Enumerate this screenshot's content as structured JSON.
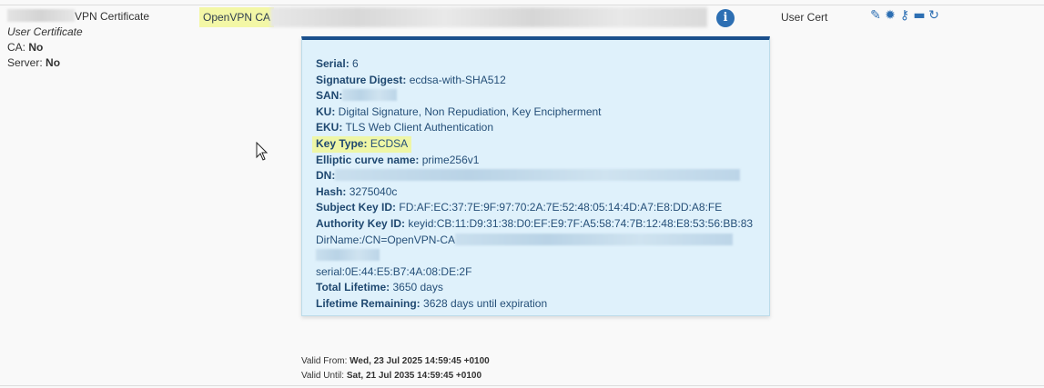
{
  "row": {
    "name_suffix": "VPN Certificate",
    "type_italic": "User Certificate",
    "ca_label": "CA:",
    "ca_value": "No",
    "server_label": "Server:",
    "server_value": "No",
    "issuer": "OpenVPN CA",
    "cert_type": "User Cert"
  },
  "icons": {
    "info": "info-icon",
    "actions": [
      "pencil-icon",
      "gear-icon",
      "key-icon",
      "archive-icon",
      "refresh-icon"
    ]
  },
  "details": {
    "serial_label": "Serial:",
    "serial": "6",
    "digest_label": "Signature Digest:",
    "digest": "ecdsa-with-SHA512",
    "san_label": "SAN:",
    "ku_label": "KU:",
    "ku": "Digital Signature, Non Repudiation, Key Encipherment",
    "eku_label": "EKU:",
    "eku": "TLS Web Client Authentication",
    "keytype_label": "Key Type:",
    "keytype": "ECDSA",
    "curve_label": "Elliptic curve name:",
    "curve": "prime256v1",
    "dn_label": "DN:",
    "hash_label": "Hash:",
    "hash": "3275040c",
    "skid_label": "Subject Key ID:",
    "skid": "FD:AF:EC:37:7E:9F:97:70:2A:7E:52:48:05:14:4D:A7:E8:DD:A8:FE",
    "akid_label": "Authority Key ID:",
    "akid": "keyid:CB:11:D9:31:38:D0:EF:E9:7F:A5:58:74:7B:12:48:E8:53:56:BB:83",
    "dirname": "DirName:/CN=OpenVPN-CA",
    "akid_serial": "serial:0E:44:E5:B7:4A:08:DE:2F",
    "lifetime_label": "Total Lifetime:",
    "lifetime": "3650 days",
    "remaining_label": "Lifetime Remaining:",
    "remaining": "3628 days until expiration"
  },
  "validity": {
    "from_label": "Valid From:",
    "from": "Wed, 23 Jul 2025 14:59:45 +0100",
    "until_label": "Valid Until:",
    "until": "Sat, 21 Jul 2035 14:59:45 +0100"
  },
  "colors": {
    "popover_bg": "#dff1fb",
    "popover_border": "#1a4f8c",
    "highlight": "#eef6a6",
    "accent": "#2d6fb3"
  }
}
